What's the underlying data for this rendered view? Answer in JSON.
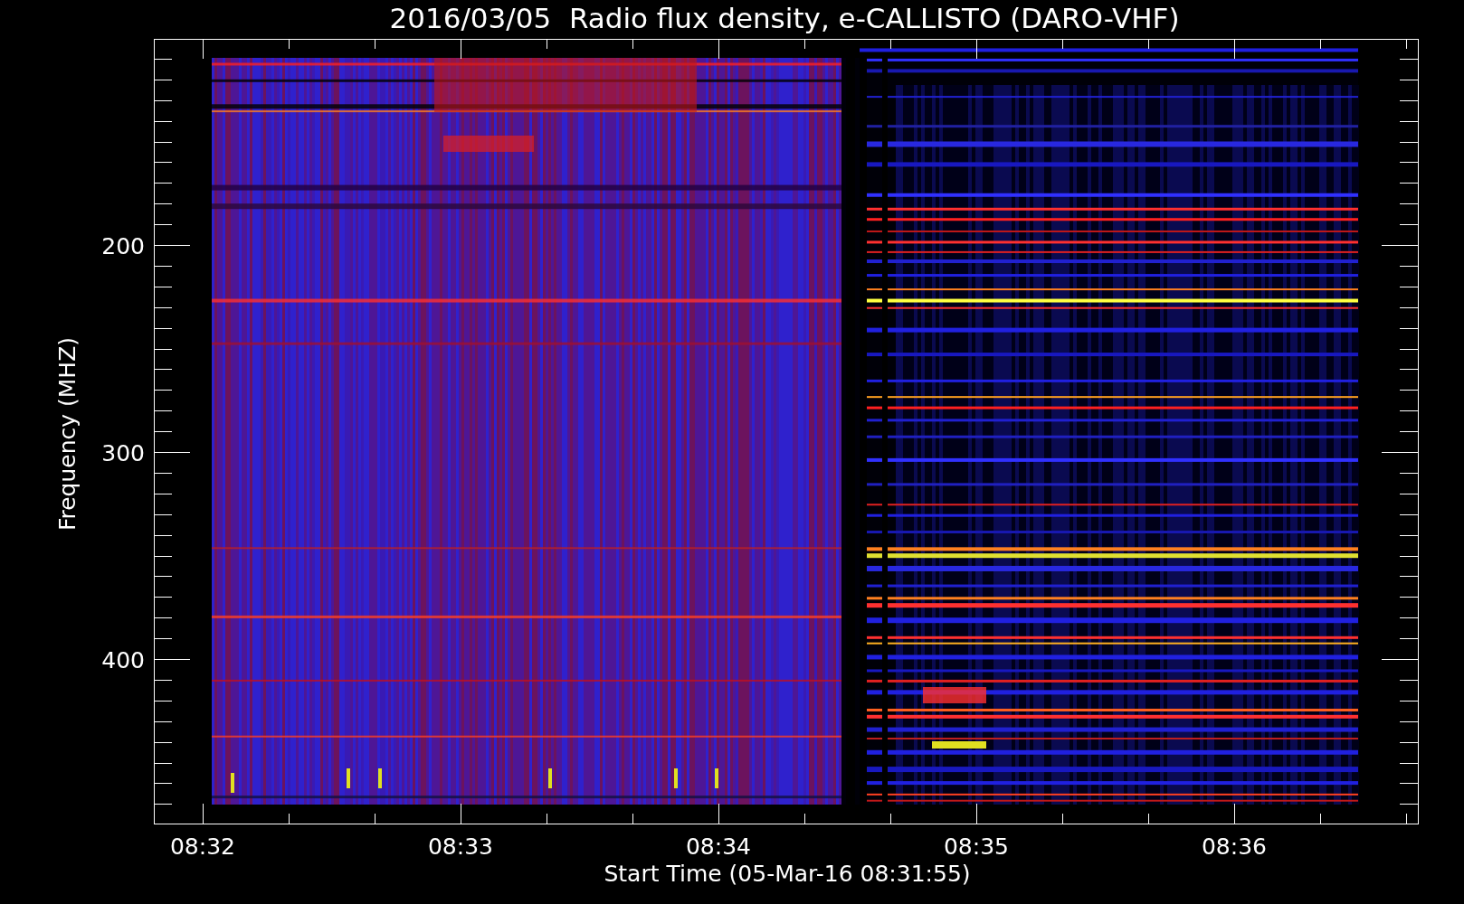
{
  "title": "2016/03/05  Radio flux density, e-CALLISTO (DARO-VHF)",
  "y_axis": {
    "label": "Frequency (MHZ)",
    "ticks": [
      "200",
      "300",
      "400"
    ]
  },
  "x_axis": {
    "label": "Start Time (05-Mar-16 08:31:55)",
    "ticks": [
      "08:32",
      "08:33",
      "08:34",
      "08:35",
      "08:36"
    ]
  }
}
